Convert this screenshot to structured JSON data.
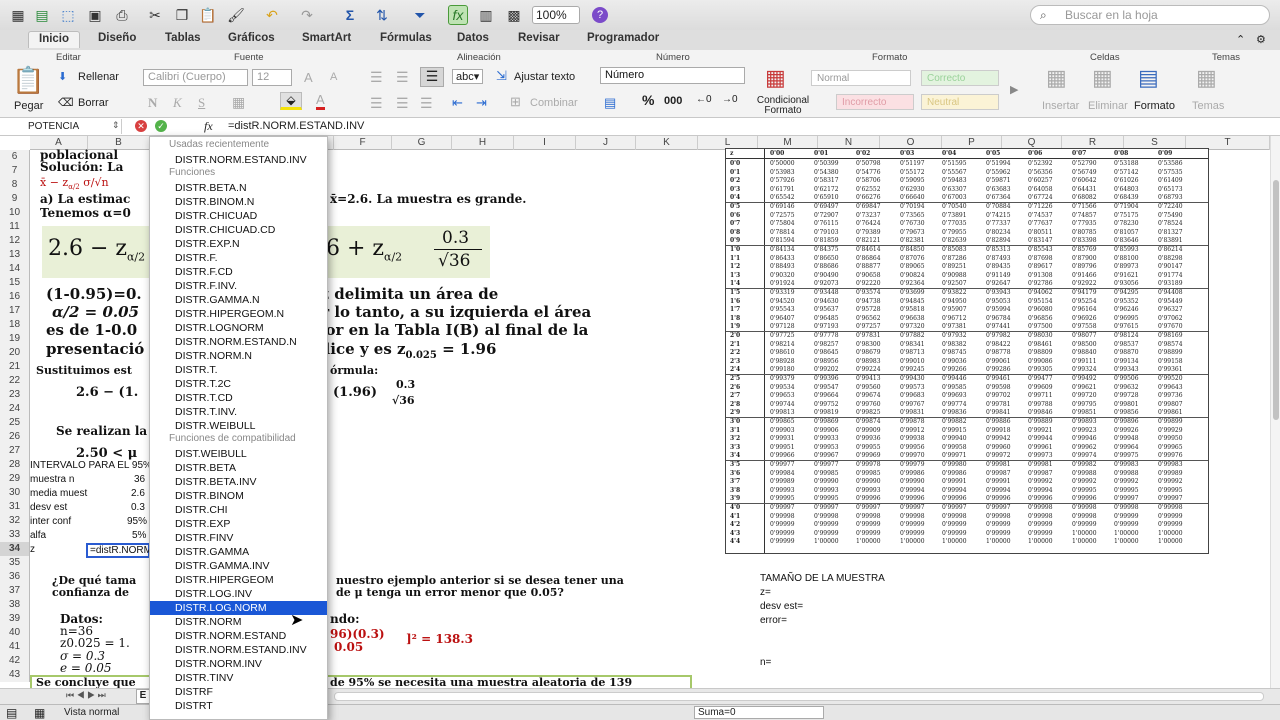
{
  "toolbar": {
    "zoom": "100%",
    "search_placeholder": "Buscar en la hoja"
  },
  "tabs": [
    "Inicio",
    "Diseño",
    "Tablas",
    "Gráficos",
    "SmartArt",
    "Fórmulas",
    "Datos",
    "Revisar",
    "Programador"
  ],
  "ribbon": {
    "groups": [
      "Editar",
      "Fuente",
      "Alineación",
      "Número",
      "Formato",
      "Celdas",
      "Temas"
    ],
    "rellenar": "Rellenar",
    "borrar": "Borrar",
    "pegar": "Pegar",
    "font_name": "Calibri (Cuerpo)",
    "font_size": "12",
    "ajustar": "Ajustar texto",
    "combinar": "Combinar",
    "num_format": "Número",
    "cond_format": "Condicional Formato",
    "styles": [
      "Normal",
      "Correcto",
      "Incorrecto",
      "Neutral"
    ],
    "insertar": "Insertar",
    "eliminar": "Eliminar",
    "formato": "Formato",
    "temas": "Temas"
  },
  "formula_bar": {
    "name_box": "POTENCIA",
    "fx": "fx",
    "formula": "=distR.NORM.ESTAND.INV"
  },
  "columns": [
    "A",
    "B",
    "C",
    "D",
    "E",
    "F",
    "G",
    "H",
    "I",
    "J",
    "K",
    "L",
    "M",
    "N",
    "O",
    "P",
    "Q",
    "R",
    "S",
    "T"
  ],
  "rows": [
    "6",
    "7",
    "8",
    "9",
    "10",
    "11",
    "12",
    "13",
    "14",
    "15",
    "16",
    "17",
    "18",
    "19",
    "20",
    "21",
    "22",
    "23",
    "24",
    "25",
    "26",
    "27",
    "28",
    "29",
    "30",
    "31",
    "32",
    "33",
    "34",
    "35",
    "36",
    "37",
    "38",
    "39",
    "40",
    "41",
    "42",
    "43"
  ],
  "doc_text": {
    "l6": "poblacional",
    "l7": "Solución: La",
    "l9": "a) La estimac",
    "l9b": "x̄=2.6. La muestra es grande.",
    "l10": "Tenemos α=0",
    "eq1a": "2.6 − z",
    "eq1sub": "α/2",
    "eq1b": "6 + z",
    "eq1sub2": "α/2",
    "eq1num": "0.3",
    "eq1den": "√36",
    "l16": "(1-0.95)=0.",
    "l16b": "valor de z delimita un área de",
    "l17": "α/2 = 0.05",
    "l17b": "cha y, por lo tanto, a su izquierda el área",
    "l18": "es de 1-0.0",
    "l18b": "s este valor en la Tabla I(B) al final de la",
    "l19": "presentació",
    "l19b": "mo apéndice y es z",
    "l19sub": "0.025",
    "l19c": "= 1.96",
    "l21": "Sustituimos est",
    "l21b": "órmula:",
    "l22": "2.6 − (1.",
    "l22b": "(1.96)",
    "l22num": "0.3",
    "l22den": "√36",
    "l25": "Se realizan la",
    "l27": "2.50 < μ",
    "l36": "¿De qué tama",
    "l36b": "nuestro ejemplo anterior si se desea tener una",
    "l37": "confianza de",
    "l37b": "de μ tenga un error menor que 0.05?",
    "l39": "Datos:",
    "l39b": "ndo:",
    "l40": "n=36",
    "l41": "z0.025 = 1.",
    "l41b": "96)(0.3)",
    "l41c": "]² = 138.3",
    "l41d": "0.05",
    "l42": "σ = 0.3",
    "l43": "e = 0.05",
    "l44": "Se concluye que",
    "l44b": "de 95% se necesita una muestra aleatoria de 139"
  },
  "cells": {
    "a28": "INTERVALO PARA EL 95% D",
    "a29": "muestra n",
    "b29": "36",
    "a30": "media muest",
    "b30": "2.6",
    "a31": "desv est",
    "b31": "0.3",
    "a32": "inter conf",
    "b32": "95%",
    "a33": "alfa",
    "b33": "5%",
    "a34": "z",
    "b34": "=distR.NORM"
  },
  "sample_size": {
    "title": "TAMAÑO DE LA MUESTRA",
    "z": "z=",
    "desv": "desv est=",
    "error": "error=",
    "n": "n="
  },
  "normal_table": {
    "header": [
      "z",
      "0'00",
      "0'01",
      "0'02",
      "0'03",
      "0'04",
      "0'05",
      "0'06",
      "0'07",
      "0'08",
      "0'09"
    ],
    "rows": [
      [
        "0'0",
        "0'50000",
        "0'50399",
        "0'50798",
        "0'51197",
        "0'51595",
        "0'51994",
        "0'52392",
        "0'52790",
        "0'53188",
        "0'53586"
      ],
      [
        "0'1",
        "0'53983",
        "0'54380",
        "0'54776",
        "0'55172",
        "0'55567",
        "0'55962",
        "0'56356",
        "0'56749",
        "0'57142",
        "0'57535"
      ],
      [
        "0'2",
        "0'57926",
        "0'58317",
        "0'58706",
        "0'59095",
        "0'59483",
        "0'59871",
        "0'60257",
        "0'60642",
        "0'61026",
        "0'61409"
      ],
      [
        "0'3",
        "0'61791",
        "0'62172",
        "0'62552",
        "0'62930",
        "0'63307",
        "0'63683",
        "0'64058",
        "0'64431",
        "0'64803",
        "0'65173"
      ],
      [
        "0'4",
        "0'65542",
        "0'65910",
        "0'66276",
        "0'66640",
        "0'67003",
        "0'67364",
        "0'67724",
        "0'68082",
        "0'68439",
        "0'68793"
      ],
      [
        "0'5",
        "0'69146",
        "0'69497",
        "0'69847",
        "0'70194",
        "0'70540",
        "0'70884",
        "0'71226",
        "0'71566",
        "0'71904",
        "0'72240"
      ],
      [
        "0'6",
        "0'72575",
        "0'72907",
        "0'73237",
        "0'73565",
        "0'73891",
        "0'74215",
        "0'74537",
        "0'74857",
        "0'75175",
        "0'75490"
      ],
      [
        "0'7",
        "0'75804",
        "0'76115",
        "0'76424",
        "0'76730",
        "0'77035",
        "0'77337",
        "0'77637",
        "0'77935",
        "0'78230",
        "0'78524"
      ],
      [
        "0'8",
        "0'78814",
        "0'79103",
        "0'79389",
        "0'79673",
        "0'79955",
        "0'80234",
        "0'80511",
        "0'80785",
        "0'81057",
        "0'81327"
      ],
      [
        "0'9",
        "0'81594",
        "0'81859",
        "0'82121",
        "0'82381",
        "0'82639",
        "0'82894",
        "0'83147",
        "0'83398",
        "0'83646",
        "0'83891"
      ],
      [
        "1'0",
        "0'84134",
        "0'84375",
        "0'84614",
        "0'84850",
        "0'85083",
        "0'85313",
        "0'85543",
        "0'85769",
        "0'85993",
        "0'86214"
      ],
      [
        "1'1",
        "0'86433",
        "0'86650",
        "0'86864",
        "0'87076",
        "0'87286",
        "0'87493",
        "0'87698",
        "0'87900",
        "0'88100",
        "0'88298"
      ],
      [
        "1'2",
        "0'88493",
        "0'88686",
        "0'88877",
        "0'89065",
        "0'89251",
        "0'89435",
        "0'89617",
        "0'89796",
        "0'89973",
        "0'90147"
      ],
      [
        "1'3",
        "0'90320",
        "0'90490",
        "0'90658",
        "0'90824",
        "0'90988",
        "0'91149",
        "0'91308",
        "0'91466",
        "0'91621",
        "0'91774"
      ],
      [
        "1'4",
        "0'91924",
        "0'92073",
        "0'92220",
        "0'92364",
        "0'92507",
        "0'92647",
        "0'92786",
        "0'92922",
        "0'93056",
        "0'93189"
      ],
      [
        "1'5",
        "0'93319",
        "0'93448",
        "0'93574",
        "0'93699",
        "0'93822",
        "0'93943",
        "0'94062",
        "0'94179",
        "0'94295",
        "0'94408"
      ],
      [
        "1'6",
        "0'94520",
        "0'94630",
        "0'94738",
        "0'94845",
        "0'94950",
        "0'95053",
        "0'95154",
        "0'95254",
        "0'95352",
        "0'95449"
      ],
      [
        "1'7",
        "0'95543",
        "0'95637",
        "0'95728",
        "0'95818",
        "0'95907",
        "0'95994",
        "0'96080",
        "0'96164",
        "0'96246",
        "0'96327"
      ],
      [
        "1'8",
        "0'96407",
        "0'96485",
        "0'96562",
        "0'96638",
        "0'96712",
        "0'96784",
        "0'96856",
        "0'96926",
        "0'96995",
        "0'97062"
      ],
      [
        "1'9",
        "0'97128",
        "0'97193",
        "0'97257",
        "0'97320",
        "0'97381",
        "0'97441",
        "0'97500",
        "0'97558",
        "0'97615",
        "0'97670"
      ],
      [
        "2'0",
        "0'97725",
        "0'97778",
        "0'97831",
        "0'97882",
        "0'97932",
        "0'97982",
        "0'98030",
        "0'98077",
        "0'98124",
        "0'98169"
      ],
      [
        "2'1",
        "0'98214",
        "0'98257",
        "0'98300",
        "0'98341",
        "0'98382",
        "0'98422",
        "0'98461",
        "0'98500",
        "0'98537",
        "0'98574"
      ],
      [
        "2'2",
        "0'98610",
        "0'98645",
        "0'98679",
        "0'98713",
        "0'98745",
        "0'98778",
        "0'98809",
        "0'98840",
        "0'98870",
        "0'98899"
      ],
      [
        "2'3",
        "0'98928",
        "0'98956",
        "0'98983",
        "0'99010",
        "0'99036",
        "0'99061",
        "0'99086",
        "0'99111",
        "0'99134",
        "0'99158"
      ],
      [
        "2'4",
        "0'99180",
        "0'99202",
        "0'99224",
        "0'99245",
        "0'99266",
        "0'99286",
        "0'99305",
        "0'99324",
        "0'99343",
        "0'99361"
      ],
      [
        "2'5",
        "0'99379",
        "0'99396",
        "0'99413",
        "0'99430",
        "0'99446",
        "0'99461",
        "0'99477",
        "0'99492",
        "0'99506",
        "0'99520"
      ],
      [
        "2'6",
        "0'99534",
        "0'99547",
        "0'99560",
        "0'99573",
        "0'99585",
        "0'99598",
        "0'99609",
        "0'99621",
        "0'99632",
        "0'99643"
      ],
      [
        "2'7",
        "0'99653",
        "0'99664",
        "0'99674",
        "0'99683",
        "0'99693",
        "0'99702",
        "0'99711",
        "0'99720",
        "0'99728",
        "0'99736"
      ],
      [
        "2'8",
        "0'99744",
        "0'99752",
        "0'99760",
        "0'99767",
        "0'99774",
        "0'99781",
        "0'99788",
        "0'99795",
        "0'99801",
        "0'99807"
      ],
      [
        "2'9",
        "0'99813",
        "0'99819",
        "0'99825",
        "0'99831",
        "0'99836",
        "0'99841",
        "0'99846",
        "0'99851",
        "0'99856",
        "0'99861"
      ],
      [
        "3'0",
        "0'99865",
        "0'99869",
        "0'99874",
        "0'99878",
        "0'99882",
        "0'99886",
        "0'99889",
        "0'99893",
        "0'99896",
        "0'99899"
      ],
      [
        "3'1",
        "0'99903",
        "0'99906",
        "0'99909",
        "0'99912",
        "0'99915",
        "0'99918",
        "0'99921",
        "0'99923",
        "0'99926",
        "0'99929"
      ],
      [
        "3'2",
        "0'99931",
        "0'99933",
        "0'99936",
        "0'99938",
        "0'99940",
        "0'99942",
        "0'99944",
        "0'99946",
        "0'99948",
        "0'99950"
      ],
      [
        "3'3",
        "0'99951",
        "0'99953",
        "0'99955",
        "0'99956",
        "0'99958",
        "0'99960",
        "0'99961",
        "0'99962",
        "0'99964",
        "0'99965"
      ],
      [
        "3'4",
        "0'99966",
        "0'99967",
        "0'99969",
        "0'99970",
        "0'99971",
        "0'99972",
        "0'99973",
        "0'99974",
        "0'99975",
        "0'99976"
      ],
      [
        "3'5",
        "0'99977",
        "0'99977",
        "0'99978",
        "0'99979",
        "0'99980",
        "0'99981",
        "0'99981",
        "0'99982",
        "0'99983",
        "0'99983"
      ],
      [
        "3'6",
        "0'99984",
        "0'99985",
        "0'99985",
        "0'99986",
        "0'99986",
        "0'99987",
        "0'99987",
        "0'99988",
        "0'99988",
        "0'99989"
      ],
      [
        "3'7",
        "0'99989",
        "0'99990",
        "0'99990",
        "0'99990",
        "0'99991",
        "0'99991",
        "0'99992",
        "0'99992",
        "0'99992",
        "0'99992"
      ],
      [
        "3'8",
        "0'99993",
        "0'99993",
        "0'99993",
        "0'99994",
        "0'99994",
        "0'99994",
        "0'99994",
        "0'99995",
        "0'99995",
        "0'99995"
      ],
      [
        "3'9",
        "0'99995",
        "0'99995",
        "0'99996",
        "0'99996",
        "0'99996",
        "0'99996",
        "0'99996",
        "0'99996",
        "0'99997",
        "0'99997"
      ],
      [
        "4'0",
        "0'99997",
        "0'99997",
        "0'99997",
        "0'99997",
        "0'99997",
        "0'99997",
        "0'99998",
        "0'99998",
        "0'99998",
        "0'99998"
      ],
      [
        "4'1",
        "0'99998",
        "0'99998",
        "0'99998",
        "0'99998",
        "0'99998",
        "0'99998",
        "0'99998",
        "0'99998",
        "0'99999",
        "0'99999"
      ],
      [
        "4'2",
        "0'99999",
        "0'99999",
        "0'99999",
        "0'99999",
        "0'99999",
        "0'99999",
        "0'99999",
        "0'99999",
        "0'99999",
        "0'99999"
      ],
      [
        "4'3",
        "0'99999",
        "0'99999",
        "0'99999",
        "0'99999",
        "0'99999",
        "0'99999",
        "0'99999",
        "1'00000",
        "1'00000",
        "1'00000"
      ],
      [
        "4'4",
        "0'99999",
        "1'00000",
        "1'00000",
        "1'00000",
        "1'00000",
        "1'00000",
        "1'00000",
        "1'00000",
        "1'00000",
        "1'00000"
      ]
    ]
  },
  "autocomplete": {
    "h1": "Usadas recientemente",
    "recent": [
      "DISTR.NORM.ESTAND.INV"
    ],
    "h2": "Funciones",
    "functions": [
      "DISTR.BETA.N",
      "DISTR.BINOM.N",
      "DISTR.CHICUAD",
      "DISTR.CHICUAD.CD",
      "DISTR.EXP.N",
      "DISTR.F.",
      "DISTR.F.CD",
      "DISTR.F.INV.",
      "DISTR.GAMMA.N",
      "DISTR.HIPERGEOM.N",
      "DISTR.LOGNORM",
      "DISTR.NORM.ESTAND.N",
      "DISTR.NORM.N",
      "DISTR.T.",
      "DISTR.T.2C",
      "DISTR.T.CD",
      "DISTR.T.INV.",
      "DISTR.WEIBULL"
    ],
    "h3": "Funciones de compatibilidad",
    "compat": [
      "DIST.WEIBULL",
      "DISTR.BETA",
      "DISTR.BETA.INV",
      "DISTR.BINOM",
      "DISTR.CHI",
      "DISTR.EXP",
      "DISTR.FINV",
      "DISTR.GAMMA",
      "DISTR.GAMMA.INV",
      "DISTR.HIPERGEOM",
      "DISTR.LOG.INV",
      "DISTR.LOG.NORM",
      "DISTR.NORM",
      "DISTR.NORM.ESTAND",
      "DISTR.NORM.ESTAND.INV",
      "DISTR.NORM.INV",
      "DISTR.TINV",
      "DISTRF",
      "DISTRT"
    ],
    "selected": "DISTR.LOG.NORM"
  },
  "status": {
    "mode": "Vista normal",
    "sum": "Suma=0"
  }
}
